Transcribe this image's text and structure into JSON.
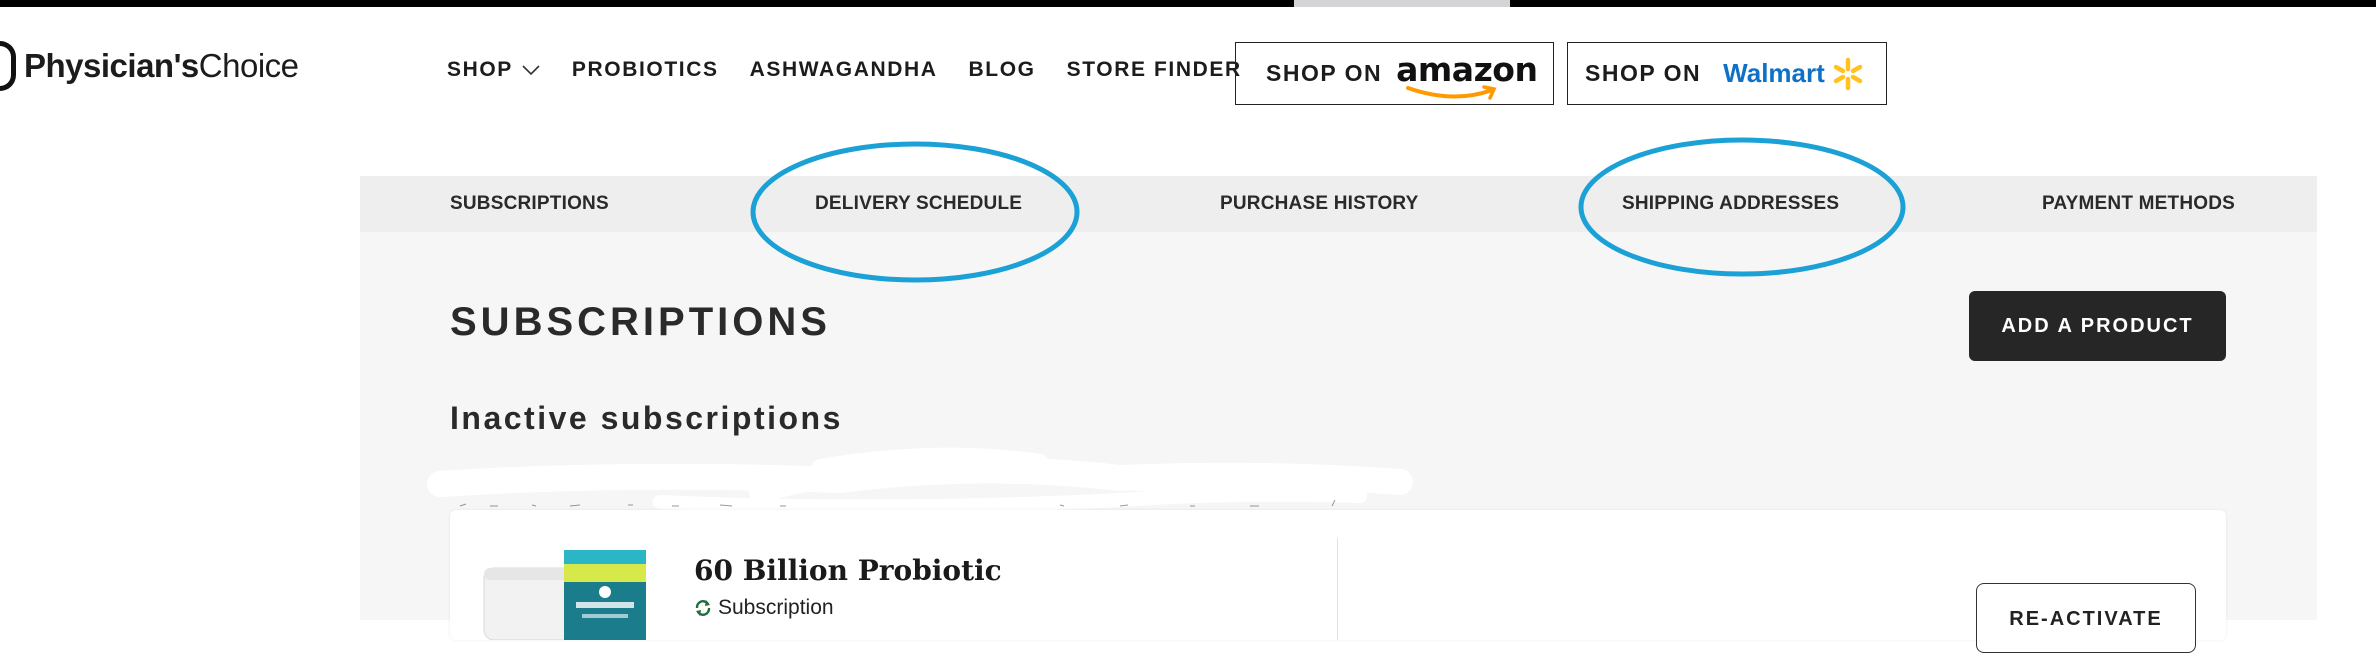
{
  "brand": {
    "bold": "Physician's",
    "light": "Choice"
  },
  "nav": {
    "items": [
      "SHOP",
      "PROBIOTICS",
      "ASHWAGANDHA",
      "BLOG",
      "STORE FINDER"
    ]
  },
  "retailers": {
    "shop_on": "SHOP ON",
    "amazon": "amazon",
    "walmart": "Walmart"
  },
  "account_tabs": [
    "SUBSCRIPTIONS",
    "DELIVERY SCHEDULE",
    "PURCHASE HISTORY",
    "SHIPPING ADDRESSES",
    "PAYMENT METHODS"
  ],
  "page": {
    "title": "SUBSCRIPTIONS",
    "add_button": "ADD A PRODUCT",
    "section_title": "Inactive subscriptions"
  },
  "subscription_card": {
    "product_name": "60 Billion Probiotic",
    "type": "Subscription",
    "reactivate_label": "RE-ACTIVATE"
  },
  "colors": {
    "annotation_circle": "#1ba1d6",
    "walmart_blue": "#0e71c7",
    "walmart_spark": "#ffc220",
    "amazon_orange": "#ff9900",
    "dark_button": "#262626"
  }
}
